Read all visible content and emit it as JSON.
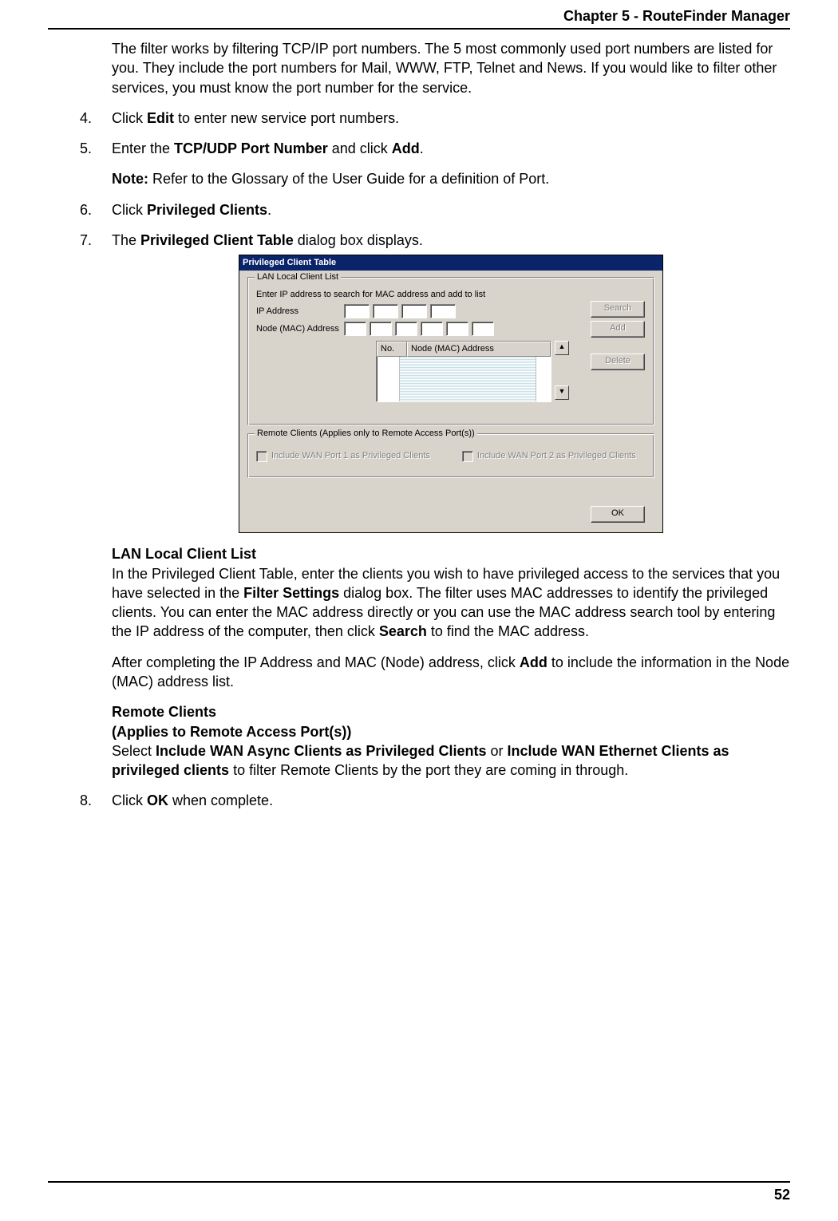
{
  "header": {
    "title": "Chapter 5 - RouteFinder Manager"
  },
  "intro": "The filter works by filtering TCP/IP port numbers.  The 5 most commonly used port numbers are listed for you.  They include the port numbers for Mail, WWW, FTP, Telnet and News.  If you would like to filter other services, you must know the port number for the service.",
  "steps": {
    "s4": {
      "num": "4.",
      "pre": "Click ",
      "b1": "Edit",
      "post": " to enter new service port numbers."
    },
    "s5": {
      "num": "5.",
      "line1_pre": "Enter the ",
      "line1_b": "TCP/UDP Port Number",
      "line1_mid": " and click ",
      "line1_b2": "Add",
      "line1_post": ".",
      "note_label": "Note:",
      "note_text": " Refer to the Glossary of the User Guide for a definition of Port."
    },
    "s6": {
      "num": "6.",
      "pre": "Click ",
      "b1": "Privileged Clients",
      "post": "."
    },
    "s7": {
      "num": "7.",
      "line1_pre": "The ",
      "line1_b": "Privileged Client Table",
      "line1_post": " dialog box displays.",
      "lan_heading": "LAN Local Client List",
      "lan_p1_a": "In the Privileged Client Table, enter the clients you wish to have privileged access to the services that you have selected in the ",
      "lan_p1_b": "Filter Settings",
      "lan_p1_c": " dialog box.  The filter uses MAC addresses to identify the privileged clients.  You can enter the MAC address directly or you can use the MAC address search tool by entering the IP address of the computer, then click ",
      "lan_p1_d": "Search",
      "lan_p1_e": " to find the MAC address.",
      "lan_p2_a": "After completing the IP Address and MAC (Node) address, click ",
      "lan_p2_b": "Add",
      "lan_p2_c": " to include the information in the Node (MAC) address list.",
      "rem_h1": "Remote Clients",
      "rem_h2": "(Applies to Remote Access Port(s))",
      "rem_a": "Select ",
      "rem_b": "Include WAN Async Clients as Privileged Clients",
      "rem_c": " or ",
      "rem_d": "Include WAN Ethernet Clients as privileged clients",
      "rem_e": " to filter Remote Clients by the port they are coming in through."
    },
    "s8": {
      "num": "8.",
      "pre": "Click ",
      "b1": "OK",
      "post": " when complete."
    }
  },
  "dialog": {
    "title": "Privileged Client Table",
    "group1": {
      "legend": "LAN Local Client List",
      "hint": "Enter IP address to search for MAC address and add to list",
      "ip_label": "IP Address",
      "mac_label": "Node (MAC) Address",
      "col_no": "No.",
      "col_mac": "Node (MAC) Address"
    },
    "buttons": {
      "search": "Search",
      "add": "Add",
      "delete": "Delete",
      "ok": "OK"
    },
    "group2": {
      "legend": "Remote Clients (Applies only to Remote Access Port(s))",
      "chk1": "Include WAN Port  1 as Privileged Clients",
      "chk2": "Include WAN Port  2 as Privileged Clients"
    },
    "scroll_up": "▲",
    "scroll_down": "▼"
  },
  "page_number": "52"
}
